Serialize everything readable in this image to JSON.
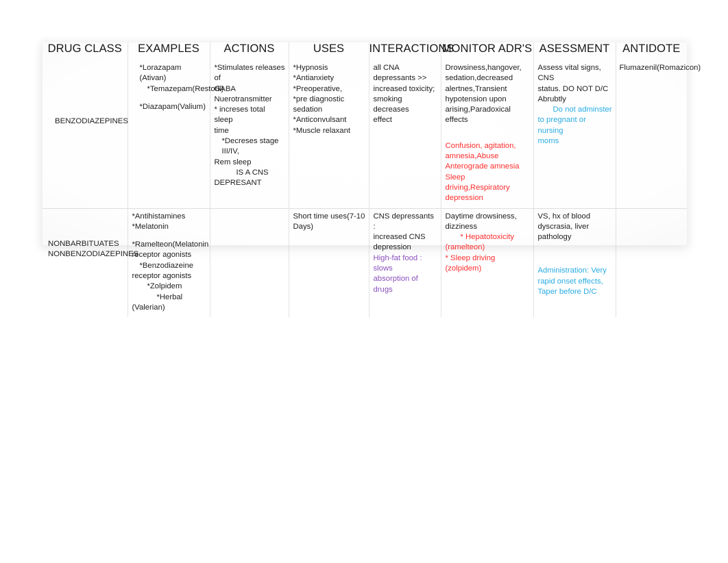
{
  "table": {
    "headers": [
      "DRUG CLASS",
      "EXAMPLES",
      "ACTIONS",
      "USES",
      "INTERACTIONS",
      "MONITOR ADR'S",
      "ASESSMENT",
      "ANTIDOTE"
    ],
    "colors": {
      "red": "#ff2d2d",
      "blue": "#29abe2",
      "purple": "#8a4fbd",
      "text": "#1d1d1d",
      "border": "#bebebe",
      "background": "#ffffff"
    },
    "rows": [
      {
        "drug_class": "BENZODIAZEPINES",
        "examples": [
          "*Lorazapam (Ativan)",
          "*Temazepam(Restoril)",
          "",
          "*Diazapam(Valium)"
        ],
        "actions": [
          "*Stimulates releases of",
          "GABA Nuerotransmitter",
          "*  increses total sleep",
          "time",
          "*Decreses stage III/IV,",
          "Rem sleep",
          "IS A CNS",
          "DEPRESANT"
        ],
        "uses": [
          "*Hypnosis",
          "*Antianxiety",
          "*Preoperative,",
          "*pre diagnostic sedation",
          "*Anticonvulsant",
          "*Muscle relaxant"
        ],
        "interactions": [
          "all CNA depressants >>",
          "increased toxicity;",
          "smoking decreases",
          "effect"
        ],
        "monitor_adrs_black": [
          "Drowsiness,hangover,",
          "sedation,decreased",
          "alertnes,Transient",
          "hypotension upon",
          "arising,Paradoxical effects"
        ],
        "monitor_adrs_red": [
          "Confusion, agitation,",
          "amnesia,Abuse",
          "Anterograde amnesia",
          "Sleep driving,Respiratory",
          "depression"
        ],
        "assessment_black": [
          "Assess vital signs, CNS",
          "status. DO NOT D/C",
          "Abrubtly"
        ],
        "assessment_blue": [
          "Do not adminster",
          "to pregnant or nursing",
          "moms"
        ],
        "antidote": "Flumazenil(Romazicon)"
      },
      {
        "drug_class_line1": "NONBARBITUATES",
        "drug_class_line2": "NONBENZODIAZEPINES",
        "examples": [
          "*Antihistamines",
          "*Melatonin",
          "",
          "*Ramelteon(Melatonin",
          "receptor agonists",
          "*Benzodiazeine",
          "receptor agonists",
          "*Zolpidem",
          "*Herbal",
          "(Valerian)"
        ],
        "actions": [],
        "uses": [
          "Short time uses(7-10",
          "Days)"
        ],
        "interactions_black": [
          "CNS depressants :",
          "increased CNS",
          "depression"
        ],
        "interactions_purple": [
          "High-fat food : slows",
          "absorption of drugs"
        ],
        "monitor_adrs_black": [
          "Daytime drowsiness,",
          "dizziness"
        ],
        "monitor_adrs_red": [
          "* Hepatotoxicity",
          "(ramelteon)",
          "* Sleep driving (zolpidem)"
        ],
        "assessment_black": [
          "VS, hx of blood",
          "dyscrasia, liver",
          "pathology"
        ],
        "assessment_blue": [
          "Administration: Very",
          "rapid onset effects,",
          "Taper before D/C"
        ],
        "antidote": ""
      }
    ]
  }
}
